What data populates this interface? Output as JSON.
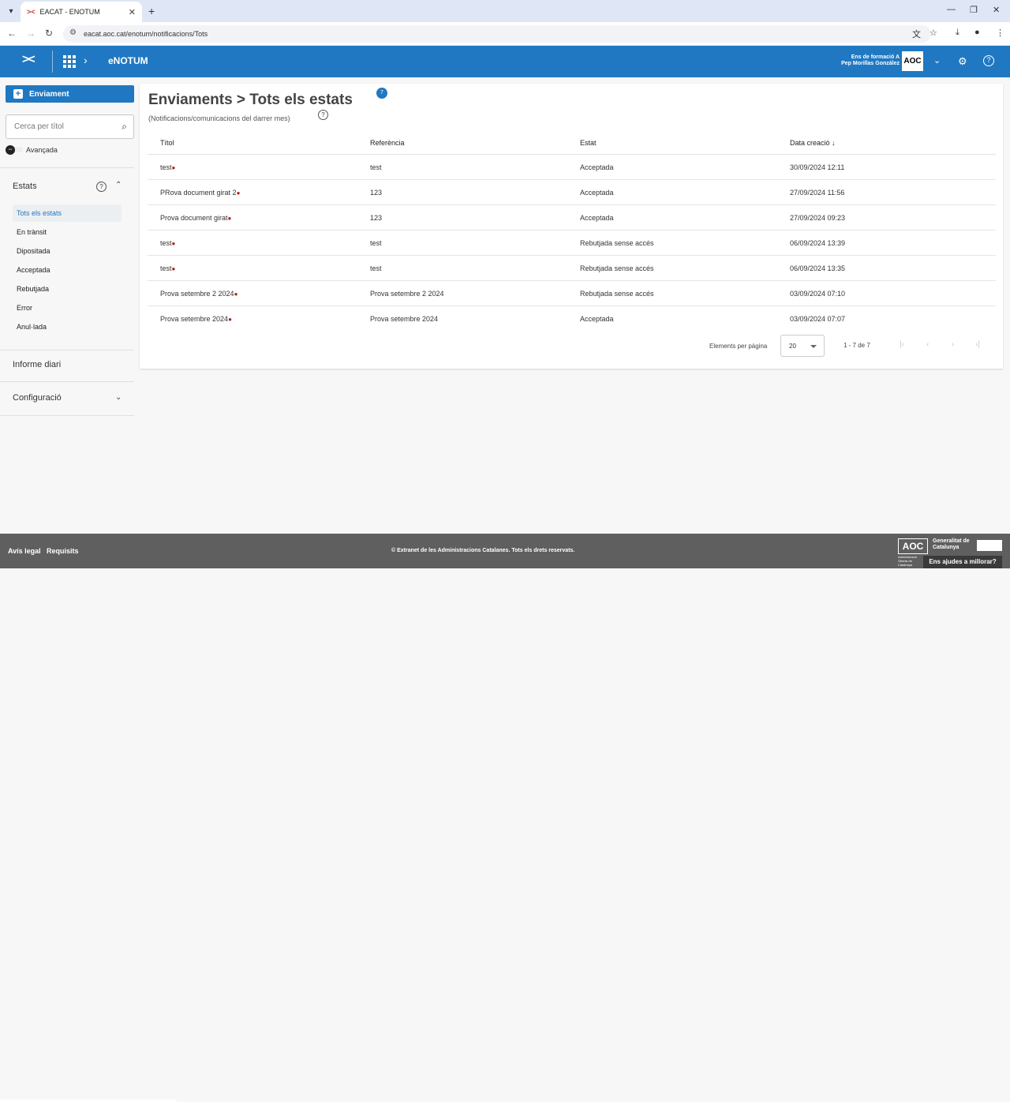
{
  "browser": {
    "tab_title": "EACAT - ENOTUM",
    "tab_favicon": "><",
    "url": "eacat.aoc.cat/enotum/notificacions/Tots"
  },
  "header": {
    "logo": "><",
    "app_name": "eNOTUM",
    "org_line1": "Ens de formació A",
    "org_line2": "Pep Morillas González",
    "org_logo": "AOC",
    "color": "#1f78c1"
  },
  "sidebar": {
    "new_button": "Enviament",
    "search_placeholder": "Cerca per títol",
    "advanced_label": "Avançada",
    "states_title": "Estats",
    "states": [
      {
        "label": "Tots els estats",
        "active": true
      },
      {
        "label": "En trànsit"
      },
      {
        "label": "Dipositada"
      },
      {
        "label": "Acceptada"
      },
      {
        "label": "Rebutjada"
      },
      {
        "label": "Error"
      },
      {
        "label": "Anul·lada"
      }
    ],
    "daily_report": "Informe diari",
    "config": "Configuració"
  },
  "main": {
    "title": "Enviaments > Tots els estats",
    "count_badge": "7",
    "subtitle": "(Notificacions/comunicacions del darrer mes)",
    "columns": [
      "Títol",
      "Referència",
      "Estat",
      "Data creació ↓"
    ],
    "rows": [
      {
        "title": "test",
        "ref": "test",
        "state": "Acceptada",
        "date": "30/09/2024 12:11"
      },
      {
        "title": "PRova document girat 2",
        "ref": "123",
        "state": "Acceptada",
        "date": "27/09/2024 11:56"
      },
      {
        "title": "Prova document girat",
        "ref": "123",
        "state": "Acceptada",
        "date": "27/09/2024 09:23"
      },
      {
        "title": "test",
        "ref": "test",
        "state": "Rebutjada sense accés",
        "date": "06/09/2024 13:39"
      },
      {
        "title": "test",
        "ref": "test",
        "state": "Rebutjada sense accés",
        "date": "06/09/2024 13:35"
      },
      {
        "title": "Prova setembre 2 2024",
        "ref": "Prova setembre 2 2024",
        "state": "Rebutjada sense accés",
        "date": "03/09/2024 07:10"
      },
      {
        "title": "Prova setembre 2024",
        "ref": "Prova setembre 2024",
        "state": "Acceptada",
        "date": "03/09/2024 07:07"
      }
    ],
    "pager": {
      "label": "Elements per pàgina",
      "per_page": "20",
      "range": "1 - 7 de 7"
    }
  },
  "footer": {
    "legal": "Avís legal",
    "requirements": "Requisits",
    "copyright": "© Extranet de les Administracions Catalanes. Tots els drets reservats.",
    "logo_aoc": "AOC",
    "logo_aoc_sub": "Administració Oberta de Catalunya",
    "logo_gencat": "Generalitat de Catalunya",
    "help": "Ens ajudes a millorar?"
  }
}
